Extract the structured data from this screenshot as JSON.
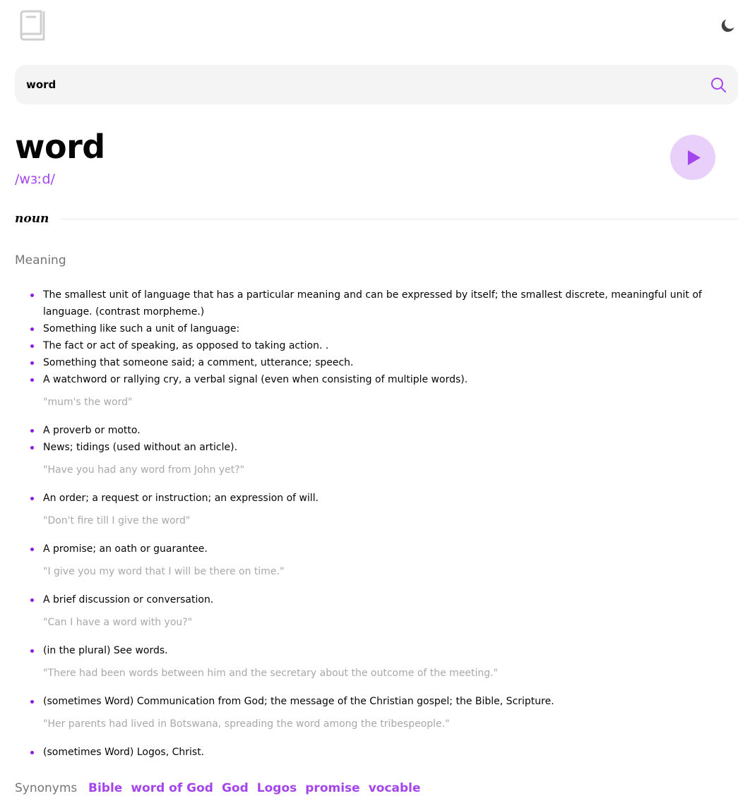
{
  "search": {
    "value": "word"
  },
  "entry": {
    "word": "word",
    "phonetic": "/wɜːd/",
    "part_of_speech": "noun",
    "meaning_heading": "Meaning",
    "definitions": [
      {
        "text": "The smallest unit of language that has a particular meaning and can be expressed by itself; the smallest discrete, meaningful unit of language. (contrast morpheme.)"
      },
      {
        "text": "Something like such a unit of language:"
      },
      {
        "text": "The fact or act of speaking, as opposed to taking action. ."
      },
      {
        "text": "Something that someone said; a comment, utterance; speech."
      },
      {
        "text": "A watchword or rallying cry, a verbal signal (even when consisting of multiple words).",
        "example": "\"mum's the word\""
      },
      {
        "text": "A proverb or motto."
      },
      {
        "text": "News; tidings (used without an article).",
        "example": "\"Have you had any word from John yet?\""
      },
      {
        "text": "An order; a request or instruction; an expression of will.",
        "example": "\"Don't fire till I give the word\""
      },
      {
        "text": "A promise; an oath or guarantee.",
        "example": "\"I give you my word that I will be there on time.\""
      },
      {
        "text": "A brief discussion or conversation.",
        "example": "\"Can I have a word with you?\""
      },
      {
        "text": "(in the plural) See words.",
        "example": "\"There had been words between him and the secretary about the outcome of the meeting.\""
      },
      {
        "text": "(sometimes Word) Communication from God; the message of the Christian gospel; the Bible, Scripture.",
        "example": "\"Her parents had lived in Botswana, spreading the word among the tribespeople.\""
      },
      {
        "text": "(sometimes Word) Logos, Christ."
      }
    ],
    "synonyms_label": "Synonyms",
    "synonyms": [
      "Bible",
      "word of God",
      "God",
      "Logos",
      "promise",
      "vocable"
    ]
  },
  "icons": {
    "logo": "book-icon",
    "theme": "moon-icon",
    "search": "search-icon",
    "play": "play-icon"
  },
  "colors": {
    "accent": "#a445ed",
    "accent_light": "#e9d0fa",
    "bullet": "#8f19e8",
    "muted": "#757575",
    "example": "#a8a8a8",
    "search_bg": "#f4f4f4"
  }
}
